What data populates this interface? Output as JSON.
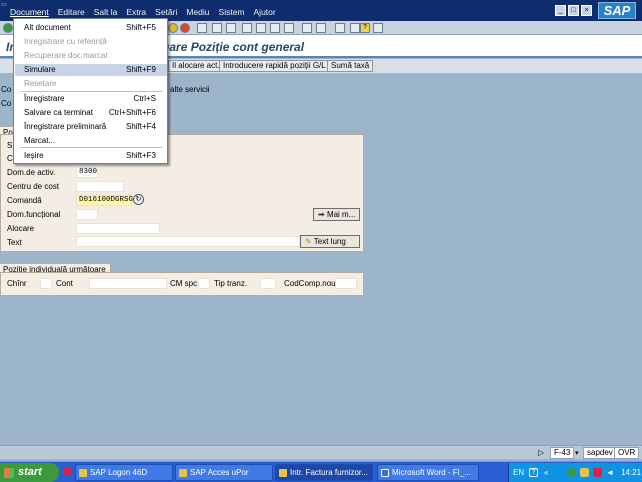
{
  "menubar": {
    "items": [
      "Document",
      "Editare",
      "Salt la",
      "Extra",
      "Setări",
      "Mediu",
      "Sistem",
      "Ajutor"
    ],
    "logo": "SAP"
  },
  "title": "Intr. Factura furnizor: Adăugare Poziție cont general",
  "title_visible": "Ir",
  "title_visible_right": "gare Poziție cont general",
  "appbar": {
    "buttons": [
      "Il alocare act...",
      "Introducere rapidă poziții G/L",
      "Sumă taxă"
    ]
  },
  "left_labels": [
    "Co",
    "Co",
    "Po",
    "S",
    "C",
    "Co"
  ],
  "info_text": "alte servicii",
  "dropdown": {
    "items": [
      {
        "label": "Alt document",
        "shortcut": "Shift+F5",
        "enabled": true
      },
      {
        "label": "Inregistrare cu referință",
        "shortcut": "",
        "enabled": false
      },
      {
        "label": "Recuperare doc.marcat",
        "shortcut": "",
        "enabled": false
      },
      {
        "label": "Simulare",
        "shortcut": "Shift+F9",
        "enabled": true
      },
      {
        "label": "Resetare",
        "shortcut": "",
        "enabled": false
      },
      {
        "label": "Înregistrare",
        "shortcut": "Ctrl+S",
        "enabled": true
      },
      {
        "label": "Salvare ca terminat",
        "shortcut": "Ctrl+Shift+F6",
        "enabled": true
      },
      {
        "label": "Înregistrare preliminară",
        "shortcut": "Shift+F4",
        "enabled": true
      },
      {
        "label": "Marcat...",
        "shortcut": "",
        "enabled": true
      },
      {
        "label": "Ieșire",
        "shortcut": "Shift+F3",
        "enabled": true
      }
    ]
  },
  "form": {
    "dom_activ_label": "Dom.de activ.",
    "dom_activ_value": "8300",
    "centru_cost_label": "Centru de cost",
    "comanda_label": "Comandă",
    "comanda_value": "D016100DGRSG",
    "dom_functional_label": "Dom.funcțional",
    "alocare_label": "Alocare",
    "text_label": "Text",
    "mai_multe": "Mai m...",
    "text_lung": "Text lung"
  },
  "next_item": {
    "tab": "Poziție individuală următoare",
    "chnr_label": "Chînr",
    "cont_label": "Cont",
    "cm_spc_label": "CM spc",
    "tip_tranz_label": "Tip tranz.",
    "codcomp_label": "CodComp.nou"
  },
  "statusbar": {
    "fields": [
      "F-43",
      "sapdev",
      "OVR"
    ]
  },
  "taskbar": {
    "start": "start",
    "tasks": [
      "SAP Logon 46D",
      "SAP Acces uPor",
      "Intr. Factura furnizor...",
      "Microsoft Word - FI_..."
    ],
    "lang": "EN",
    "clock": "14:21"
  }
}
